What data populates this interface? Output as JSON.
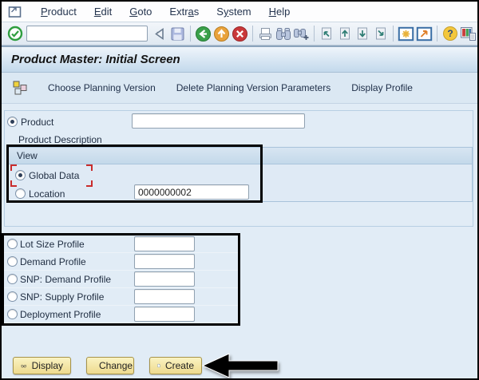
{
  "menu": {
    "items": [
      {
        "label": "Product",
        "underline": 0
      },
      {
        "label": "Edit",
        "underline": 0
      },
      {
        "label": "Goto",
        "underline": 0
      },
      {
        "label": "Extras",
        "underline": 4
      },
      {
        "label": "System",
        "underline": 1
      },
      {
        "label": "Help",
        "underline": 0
      }
    ]
  },
  "toolbar": {
    "command_value": "",
    "icons": [
      "enter",
      "command-dropdown",
      "back",
      "save",
      "back-circle",
      "exit-circle",
      "cancel-circle",
      "print",
      "find",
      "find-next",
      "first-page",
      "previous-page",
      "next-page",
      "last-page",
      "new-session",
      "create-shortcut",
      "help",
      "customize-layout"
    ]
  },
  "header": {
    "title": "Product Master: Initial Screen"
  },
  "app_toolbar": {
    "buttons": [
      {
        "label": "Choose Planning Version"
      },
      {
        "label": "Delete Planning Version Parameters"
      },
      {
        "label": "Display Profile"
      }
    ]
  },
  "form": {
    "product_label": "Product",
    "product_value": "",
    "product_description_label": "Product Description",
    "view": {
      "title": "View",
      "global_data_label": "Global Data",
      "location_label": "Location",
      "location_value": "0000000002"
    },
    "profiles": [
      {
        "label": "Lot Size Profile",
        "value": ""
      },
      {
        "label": "Demand Profile",
        "value": ""
      },
      {
        "label": "SNP: Demand Profile",
        "value": ""
      },
      {
        "label": "SNP: Supply Profile",
        "value": ""
      },
      {
        "label": "Deployment Profile",
        "value": ""
      }
    ]
  },
  "footer_buttons": [
    {
      "label": "Display"
    },
    {
      "label": "Change"
    },
    {
      "label": "Create"
    }
  ],
  "colors": {
    "content_bg": "#e1ecf6",
    "titlebar_gradient_bottom": "#c3d9ec",
    "annotation_black": "#000000",
    "button_yellow": "#eeda8e",
    "focus_red": "#c92c2c",
    "enter_green": "#2f9e3f",
    "exit_orange": "#e9a23b",
    "cancel_red": "#c9383a"
  }
}
